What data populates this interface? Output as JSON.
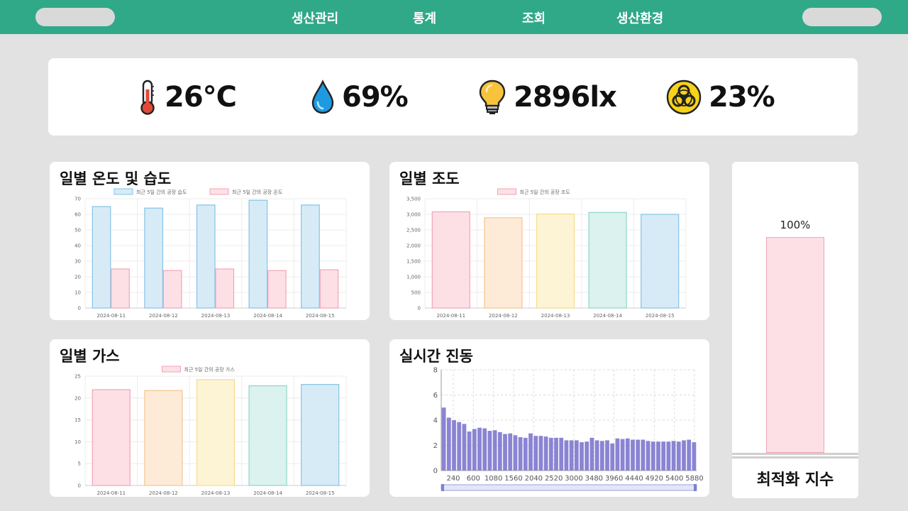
{
  "nav": {
    "items": [
      {
        "label": "생산관리",
        "x": 411
      },
      {
        "label": "통계",
        "x": 582
      },
      {
        "label": "조회",
        "x": 736
      },
      {
        "label": "생산환경",
        "x": 869
      }
    ]
  },
  "sensors": {
    "temperature": {
      "value": "26°C",
      "icon": "thermometer-icon"
    },
    "humidity": {
      "value": "69%",
      "icon": "water-drop-icon"
    },
    "illuminance": {
      "value": "2896lx",
      "icon": "light-bulb-icon"
    },
    "gas": {
      "value": "23%",
      "icon": "biohazard-icon"
    }
  },
  "charts": {
    "temp_humidity": {
      "title": "일별 온도 및 습도",
      "chart_data": {
        "type": "bar",
        "categories": [
          "2024-08-11",
          "2024-08-12",
          "2024-08-13",
          "2024-08-14",
          "2024-08-15"
        ],
        "series": [
          {
            "name": "최근 5일 간의 공장 습도",
            "values": [
              65,
              64,
              66,
              69,
              66
            ],
            "fill": "#d7ebf7",
            "stroke": "#86c3e6"
          },
          {
            "name": "최근 5일 간의 공장 온도",
            "values": [
              25,
              24,
              25,
              24,
              24.5
            ],
            "fill": "#fde0e6",
            "stroke": "#f2a4b4"
          }
        ],
        "ylim": [
          0,
          70
        ],
        "yticks": [
          "0",
          "10",
          "20",
          "30",
          "40",
          "50",
          "60",
          "70"
        ],
        "grid": true,
        "legend": "top"
      }
    },
    "illuminance": {
      "title": "일별 조도",
      "chart_data": {
        "type": "bar",
        "categories": [
          "2024-08-11",
          "2024-08-12",
          "2024-08-13",
          "2024-08-14",
          "2024-08-15"
        ],
        "series": [
          {
            "name": "최근 5일 간의 공장 조도",
            "values": [
              3080,
              2890,
              3010,
              3060,
              3000
            ]
          }
        ],
        "colors": [
          {
            "fill": "#fde0e6",
            "stroke": "#f2a4b4"
          },
          {
            "fill": "#fdebd8",
            "stroke": "#f5c48e"
          },
          {
            "fill": "#fdf4d6",
            "stroke": "#f4dc8a"
          },
          {
            "fill": "#dbf2ee",
            "stroke": "#8fd5c9"
          },
          {
            "fill": "#d7ebf7",
            "stroke": "#86c3e6"
          }
        ],
        "ylim": [
          0,
          3500
        ],
        "yticks": [
          "0",
          "500",
          "1,000",
          "1,500",
          "2,000",
          "2,500",
          "3,000",
          "3,500"
        ],
        "grid": true,
        "legend": "top"
      }
    },
    "gas": {
      "title": "일별 가스",
      "chart_data": {
        "type": "bar",
        "categories": [
          "2024-08-11",
          "2024-08-12",
          "2024-08-13",
          "2024-08-14",
          "2024-08-15"
        ],
        "series": [
          {
            "name": "최근 5일 간의 공장 가스",
            "values": [
              21.9,
              21.7,
              24.2,
              22.8,
              23.1
            ]
          }
        ],
        "colors": [
          {
            "fill": "#fde0e6",
            "stroke": "#f2a4b4"
          },
          {
            "fill": "#fdebd8",
            "stroke": "#f5c48e"
          },
          {
            "fill": "#fdf4d6",
            "stroke": "#f4dc8a"
          },
          {
            "fill": "#dbf2ee",
            "stroke": "#8fd5c9"
          },
          {
            "fill": "#d7ebf7",
            "stroke": "#86c3e6"
          }
        ],
        "ylim": [
          0,
          25
        ],
        "yticks": [
          "0",
          "5",
          "10",
          "15",
          "20",
          "25"
        ],
        "grid": true,
        "legend": "top"
      }
    },
    "vibration": {
      "title": "실시간 진동",
      "chart_data": {
        "type": "bar",
        "xtick_labels": [
          "240",
          "600",
          "1080",
          "1560",
          "2040",
          "2520",
          "3000",
          "3480",
          "3960",
          "4440",
          "4920",
          "5400",
          "5880"
        ],
        "values": [
          5.0,
          4.2,
          4.0,
          3.85,
          3.7,
          3.1,
          3.3,
          3.4,
          3.35,
          3.15,
          3.2,
          3.05,
          2.9,
          2.95,
          2.8,
          2.65,
          2.6,
          2.95,
          2.75,
          2.75,
          2.7,
          2.6,
          2.6,
          2.6,
          2.4,
          2.4,
          2.4,
          2.25,
          2.3,
          2.6,
          2.4,
          2.35,
          2.4,
          2.15,
          2.55,
          2.5,
          2.55,
          2.45,
          2.45,
          2.45,
          2.35,
          2.3,
          2.3,
          2.3,
          2.3,
          2.35,
          2.3,
          2.4,
          2.45,
          2.25
        ],
        "ylim": [
          0,
          8
        ],
        "yticks": [
          "0",
          "2",
          "4",
          "6",
          "8"
        ],
        "color": "#8a84d3",
        "grid": true
      }
    }
  },
  "optimization": {
    "percent_label": "100%",
    "value": 100,
    "label": "최적화 지수"
  }
}
